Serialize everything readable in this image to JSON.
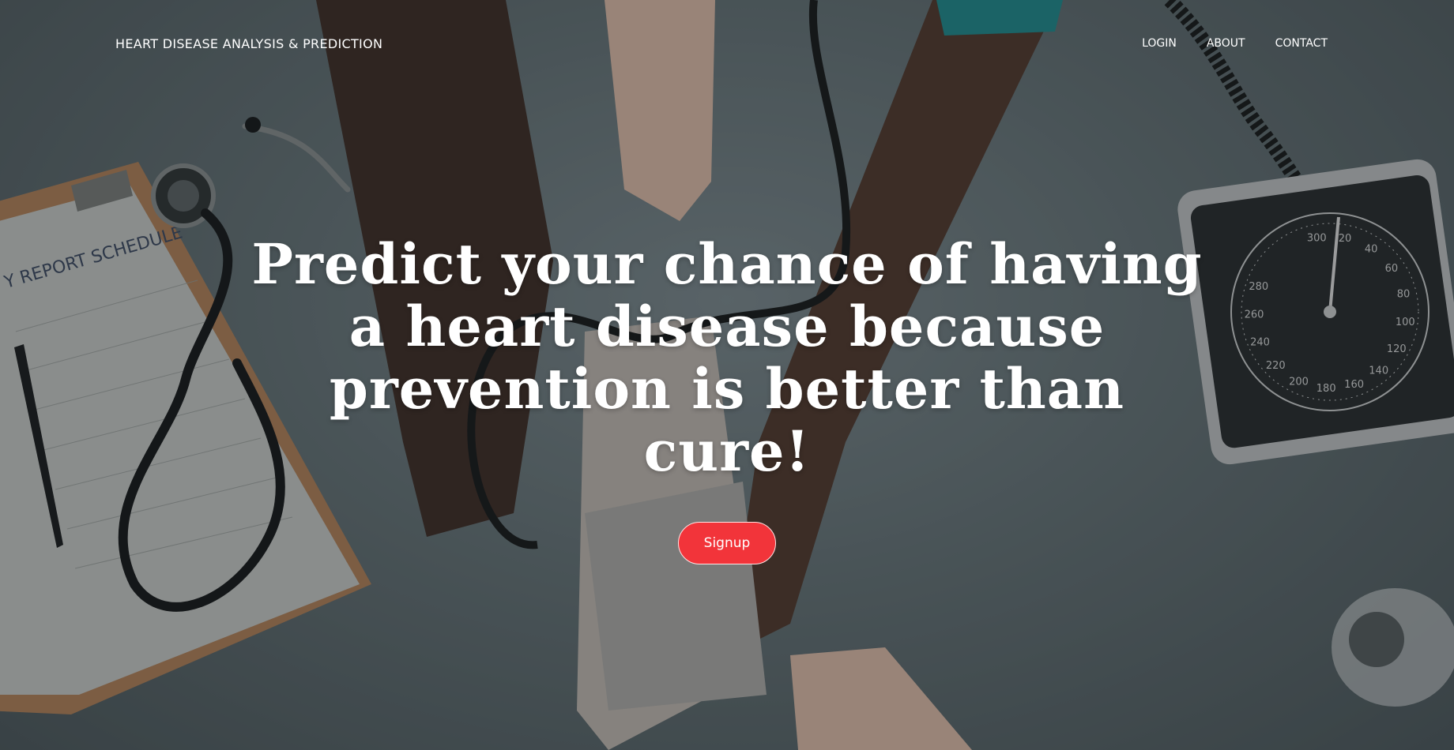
{
  "navbar": {
    "brand": "HEART DISEASE ANALYSIS & PREDICTION",
    "links": [
      "LOGIN",
      "ABOUT",
      "CONTACT"
    ]
  },
  "hero": {
    "headline": "Predict your chance of having a heart disease because prevention is better than cure!",
    "cta_label": "Signup"
  },
  "background": {
    "clipboard_text": "Y REPORT SCHEDULE",
    "gauge_numbers": [
      "300",
      "20",
      "40",
      "60",
      "80",
      "100",
      "120",
      "140",
      "160",
      "180",
      "200",
      "220",
      "240",
      "260",
      "280"
    ]
  },
  "colors": {
    "accent": "#f2343a",
    "text": "#ffffff",
    "overlay": "rgba(25,30,32,0.38)"
  }
}
